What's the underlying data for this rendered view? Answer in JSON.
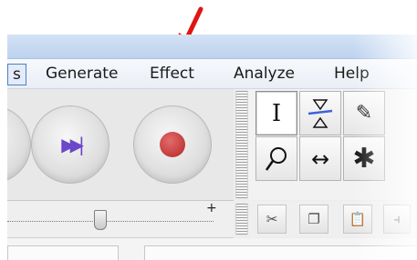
{
  "menu": {
    "items": [
      {
        "label": "s"
      },
      {
        "label": "Generate"
      },
      {
        "label": "Effect"
      },
      {
        "label": "Analyze"
      },
      {
        "label": "Help"
      }
    ]
  },
  "transport": {
    "buttons": [
      {
        "icon": "play-icon"
      },
      {
        "icon": "skip-to-end-icon",
        "glyph": "▶▶|"
      },
      {
        "icon": "record-icon"
      }
    ]
  },
  "tools": {
    "items": [
      {
        "icon": "selection-tool-icon",
        "glyph": "I",
        "active": true
      },
      {
        "icon": "envelope-tool-icon",
        "glyph": "≙",
        "active": false
      },
      {
        "icon": "draw-tool-icon",
        "glyph": "✎",
        "active": false
      },
      {
        "icon": "zoom-tool-icon",
        "glyph": "⌕",
        "active": false
      },
      {
        "icon": "timeshift-tool-icon",
        "glyph": "↔",
        "active": false
      },
      {
        "icon": "multi-tool-icon",
        "glyph": "✱",
        "active": false
      }
    ]
  },
  "slider": {
    "plus": "+",
    "value": 0.45
  },
  "edit_toolbar": {
    "buttons": [
      {
        "icon": "cut-icon",
        "glyph": "✂"
      },
      {
        "icon": "copy-icon",
        "glyph": "❐"
      },
      {
        "icon": "paste-icon",
        "glyph": "📋"
      },
      {
        "icon": "trim-icon",
        "glyph": "⫞"
      }
    ]
  },
  "colors": {
    "arrow": "#e01414",
    "record": "#c23b3b",
    "skip": "#6b47c9",
    "envelope": "#3d63d8"
  }
}
